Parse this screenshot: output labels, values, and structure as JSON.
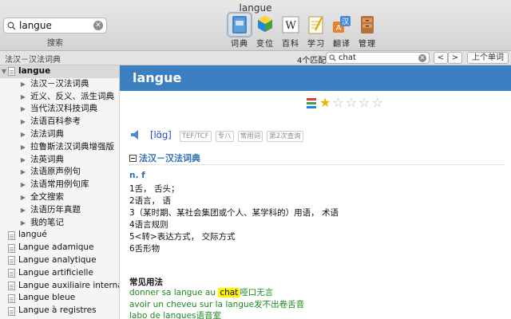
{
  "window": {
    "title": "langue"
  },
  "search": {
    "query": "langue",
    "label": "搜索"
  },
  "toolbar": {
    "tools": [
      {
        "label": "词典",
        "icon": "dictionary-icon"
      },
      {
        "label": "变位",
        "icon": "conjugation-icon"
      },
      {
        "label": "百科",
        "icon": "wikipedia-icon"
      },
      {
        "label": "学习",
        "icon": "study-icon"
      },
      {
        "label": "翻译",
        "icon": "translate-icon"
      },
      {
        "label": "管理",
        "icon": "manage-icon"
      }
    ]
  },
  "breadcrumb": "法汉－汉法词典",
  "find": {
    "count": "4个匹配",
    "query": "chat",
    "prev": "<",
    "next": ">",
    "prev_word": "上个单词"
  },
  "sidebar": {
    "root": "langue",
    "children": [
      "法汉－汉法词典",
      "近义、反义、派生词典",
      "当代法汉科技词典",
      "法语百科参考",
      "法法词典",
      "拉鲁斯法汉词典增强版",
      "法英词典",
      "法语原声例句",
      "法语常用例句库",
      "全文搜索",
      "法语历年真题",
      "我的笔记"
    ],
    "entries": [
      "langué",
      "Langue adamique",
      "Langue analytique",
      "Langue artificielle",
      "Langue auxiliaire internation",
      "Langue bleue",
      "Langue à registres"
    ]
  },
  "entry": {
    "headword": "langue",
    "rating": 1,
    "rating_max": 5,
    "ipa": "[lɑ̃g]",
    "tags": [
      "TEF/TCF",
      "专八",
      "常用词",
      "第2次查询"
    ],
    "dict": "法汉－汉法词典",
    "pos": "n. f",
    "definitions": [
      "1舌， 舌头；",
      "2语言， 语",
      "3（某时期、某社会集团或个人、某学科的）用语， 术语",
      "4语言规则",
      "5<转>表达方式， 交际方式",
      "6舌形物"
    ],
    "usage_title": "常见用法",
    "examples": [
      {
        "fr_pre": "donner sa langue au ",
        "hl": "chat",
        "zh": "哑口无言"
      },
      {
        "fr_pre": "avoir un cheveu sur la langue",
        "hl": "",
        "zh": "发不出卷舌音"
      },
      {
        "fr_pre": "labo de langues",
        "hl": "",
        "zh": "语音室"
      }
    ]
  },
  "colors": {
    "header": "#3b7fc0",
    "link": "#2f6db5",
    "example": "#1a8a1a",
    "highlight": "#fff200",
    "star": "#f0b400"
  }
}
